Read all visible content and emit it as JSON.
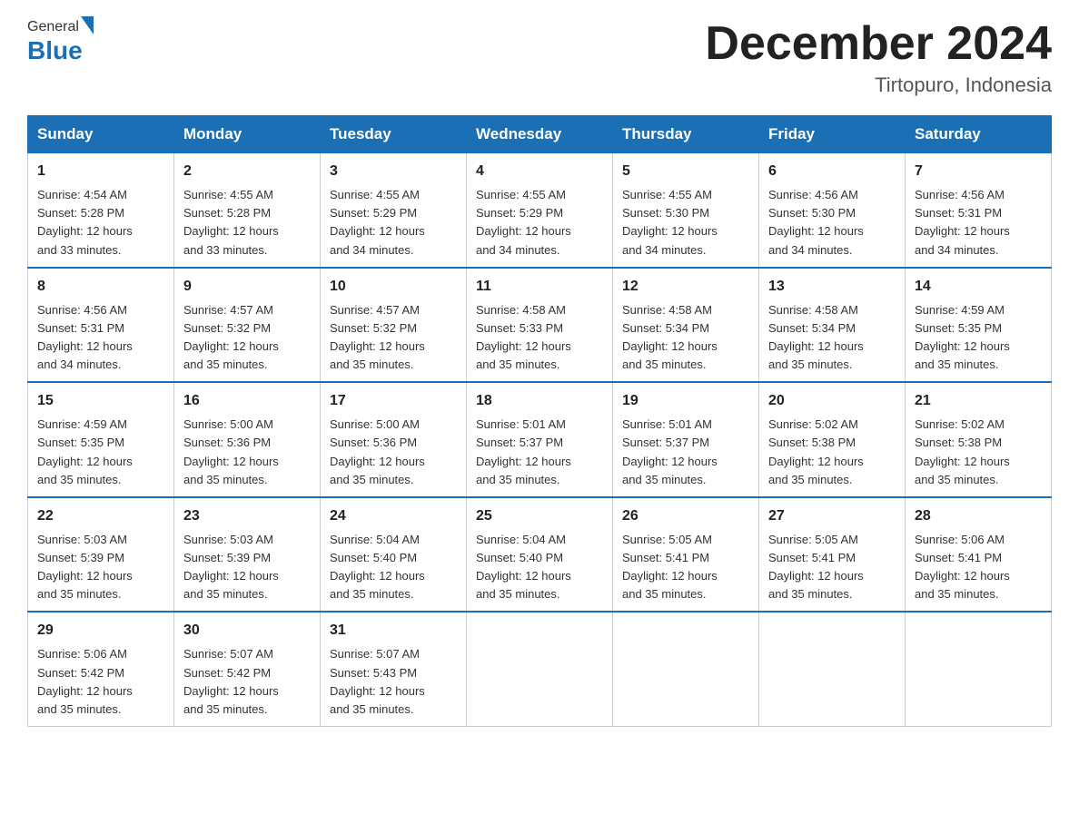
{
  "header": {
    "logo_general": "General",
    "logo_blue": "Blue",
    "month_title": "December 2024",
    "location": "Tirtopuro, Indonesia"
  },
  "days_of_week": [
    "Sunday",
    "Monday",
    "Tuesday",
    "Wednesday",
    "Thursday",
    "Friday",
    "Saturday"
  ],
  "weeks": [
    [
      {
        "day": "1",
        "sunrise": "4:54 AM",
        "sunset": "5:28 PM",
        "daylight": "12 hours and 33 minutes."
      },
      {
        "day": "2",
        "sunrise": "4:55 AM",
        "sunset": "5:28 PM",
        "daylight": "12 hours and 33 minutes."
      },
      {
        "day": "3",
        "sunrise": "4:55 AM",
        "sunset": "5:29 PM",
        "daylight": "12 hours and 34 minutes."
      },
      {
        "day": "4",
        "sunrise": "4:55 AM",
        "sunset": "5:29 PM",
        "daylight": "12 hours and 34 minutes."
      },
      {
        "day": "5",
        "sunrise": "4:55 AM",
        "sunset": "5:30 PM",
        "daylight": "12 hours and 34 minutes."
      },
      {
        "day": "6",
        "sunrise": "4:56 AM",
        "sunset": "5:30 PM",
        "daylight": "12 hours and 34 minutes."
      },
      {
        "day": "7",
        "sunrise": "4:56 AM",
        "sunset": "5:31 PM",
        "daylight": "12 hours and 34 minutes."
      }
    ],
    [
      {
        "day": "8",
        "sunrise": "4:56 AM",
        "sunset": "5:31 PM",
        "daylight": "12 hours and 34 minutes."
      },
      {
        "day": "9",
        "sunrise": "4:57 AM",
        "sunset": "5:32 PM",
        "daylight": "12 hours and 35 minutes."
      },
      {
        "day": "10",
        "sunrise": "4:57 AM",
        "sunset": "5:32 PM",
        "daylight": "12 hours and 35 minutes."
      },
      {
        "day": "11",
        "sunrise": "4:58 AM",
        "sunset": "5:33 PM",
        "daylight": "12 hours and 35 minutes."
      },
      {
        "day": "12",
        "sunrise": "4:58 AM",
        "sunset": "5:34 PM",
        "daylight": "12 hours and 35 minutes."
      },
      {
        "day": "13",
        "sunrise": "4:58 AM",
        "sunset": "5:34 PM",
        "daylight": "12 hours and 35 minutes."
      },
      {
        "day": "14",
        "sunrise": "4:59 AM",
        "sunset": "5:35 PM",
        "daylight": "12 hours and 35 minutes."
      }
    ],
    [
      {
        "day": "15",
        "sunrise": "4:59 AM",
        "sunset": "5:35 PM",
        "daylight": "12 hours and 35 minutes."
      },
      {
        "day": "16",
        "sunrise": "5:00 AM",
        "sunset": "5:36 PM",
        "daylight": "12 hours and 35 minutes."
      },
      {
        "day": "17",
        "sunrise": "5:00 AM",
        "sunset": "5:36 PM",
        "daylight": "12 hours and 35 minutes."
      },
      {
        "day": "18",
        "sunrise": "5:01 AM",
        "sunset": "5:37 PM",
        "daylight": "12 hours and 35 minutes."
      },
      {
        "day": "19",
        "sunrise": "5:01 AM",
        "sunset": "5:37 PM",
        "daylight": "12 hours and 35 minutes."
      },
      {
        "day": "20",
        "sunrise": "5:02 AM",
        "sunset": "5:38 PM",
        "daylight": "12 hours and 35 minutes."
      },
      {
        "day": "21",
        "sunrise": "5:02 AM",
        "sunset": "5:38 PM",
        "daylight": "12 hours and 35 minutes."
      }
    ],
    [
      {
        "day": "22",
        "sunrise": "5:03 AM",
        "sunset": "5:39 PM",
        "daylight": "12 hours and 35 minutes."
      },
      {
        "day": "23",
        "sunrise": "5:03 AM",
        "sunset": "5:39 PM",
        "daylight": "12 hours and 35 minutes."
      },
      {
        "day": "24",
        "sunrise": "5:04 AM",
        "sunset": "5:40 PM",
        "daylight": "12 hours and 35 minutes."
      },
      {
        "day": "25",
        "sunrise": "5:04 AM",
        "sunset": "5:40 PM",
        "daylight": "12 hours and 35 minutes."
      },
      {
        "day": "26",
        "sunrise": "5:05 AM",
        "sunset": "5:41 PM",
        "daylight": "12 hours and 35 minutes."
      },
      {
        "day": "27",
        "sunrise": "5:05 AM",
        "sunset": "5:41 PM",
        "daylight": "12 hours and 35 minutes."
      },
      {
        "day": "28",
        "sunrise": "5:06 AM",
        "sunset": "5:41 PM",
        "daylight": "12 hours and 35 minutes."
      }
    ],
    [
      {
        "day": "29",
        "sunrise": "5:06 AM",
        "sunset": "5:42 PM",
        "daylight": "12 hours and 35 minutes."
      },
      {
        "day": "30",
        "sunrise": "5:07 AM",
        "sunset": "5:42 PM",
        "daylight": "12 hours and 35 minutes."
      },
      {
        "day": "31",
        "sunrise": "5:07 AM",
        "sunset": "5:43 PM",
        "daylight": "12 hours and 35 minutes."
      },
      null,
      null,
      null,
      null
    ]
  ],
  "labels": {
    "sunrise": "Sunrise:",
    "sunset": "Sunset:",
    "daylight": "Daylight:"
  }
}
